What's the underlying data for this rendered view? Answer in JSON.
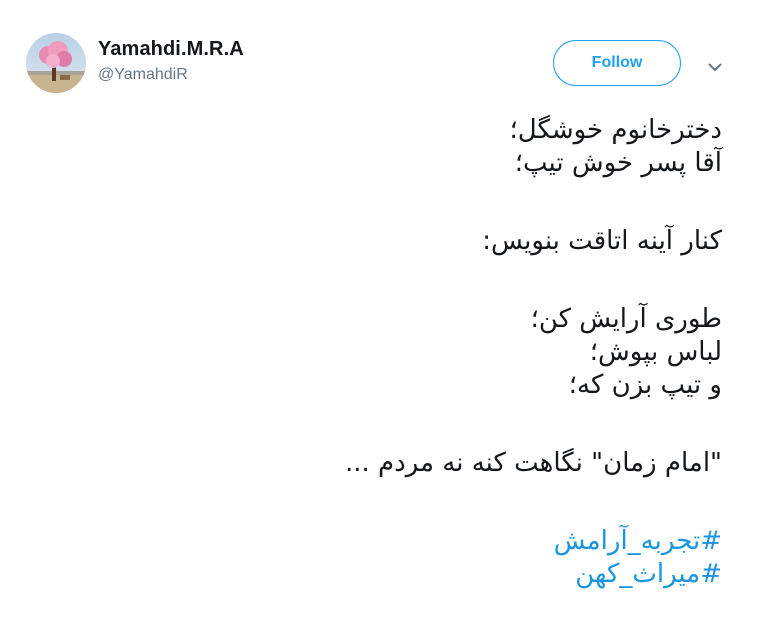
{
  "user": {
    "display_name": "Yamahdi.M.R.A",
    "handle": "@YamahdiR"
  },
  "actions": {
    "follow_label": "Follow",
    "more_icon": "chevron-down-icon"
  },
  "tweet": {
    "lines": [
      "دخترخانوم خوشگل؛",
      "آقا پسر خوش تیپ؛",
      "کنار آینه اتاقت بنویس:",
      "طوری آرایش کن؛",
      "لباس بپوش؛",
      "و تیپ بزن که؛",
      "\"امام زمان\" نگاهت کنه نه مردم ..."
    ],
    "hashtags": [
      "#تجربه_آرامش",
      "#میراث_کهن"
    ]
  },
  "colors": {
    "accent": "#1da1f2",
    "link": "#1b95e0",
    "text": "#14171a",
    "secondary": "#657786"
  }
}
